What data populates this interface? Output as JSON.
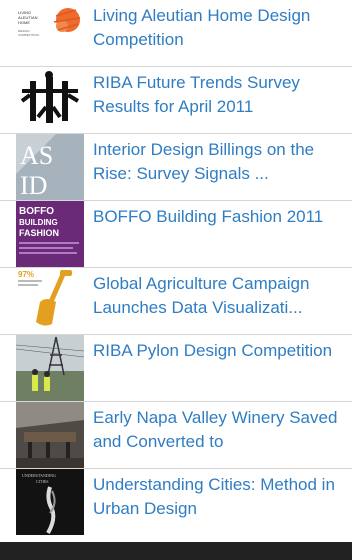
{
  "items": [
    {
      "title": "Living Aleutian Home Design Competition",
      "thumb": "aleutian-thumbnail"
    },
    {
      "title": "RIBA Future Trends Survey Results for April 2011",
      "thumb": "riba-trends-thumbnail"
    },
    {
      "title": "Interior Design Billings on the Rise: Survey Signals ...",
      "thumb": "asid-thumbnail"
    },
    {
      "title": "BOFFO Building Fashion 2011",
      "thumb": "boffo-thumbnail"
    },
    {
      "title": "Global Agriculture Campaign Launches Data Visualizati...",
      "thumb": "agriculture-thumbnail"
    },
    {
      "title": "RIBA Pylon Design Competition",
      "thumb": "pylon-thumbnail"
    },
    {
      "title": "Early Napa Valley Winery Saved and Converted to",
      "thumb": "winery-thumbnail"
    },
    {
      "title": "Understanding Cities: Method in Urban Design",
      "thumb": "cities-thumbnail"
    }
  ],
  "thumb_text": {
    "aleutian": "LIVING ALEUTIAN HOME DESIGN COMPETITION",
    "asid": "ASID",
    "boffo": "BOFFO BUILDING FASHION",
    "agri": "97%",
    "cities": "UNDERSTANDING CITIES"
  },
  "colors": {
    "link": "#2f7dc3",
    "divider": "#d6d6d6",
    "footer": "#222222"
  }
}
